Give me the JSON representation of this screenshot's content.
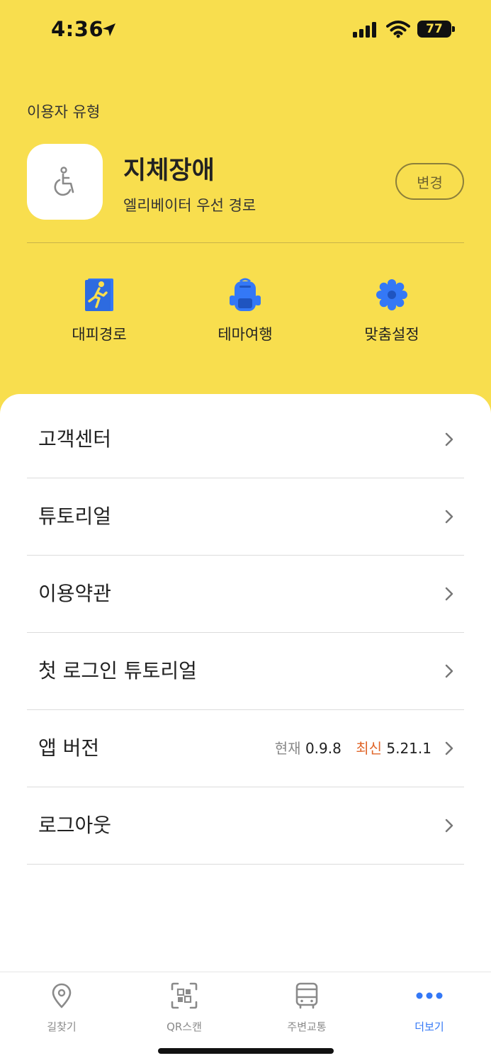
{
  "status_bar": {
    "time": "4:36",
    "battery": "77"
  },
  "user_type": {
    "section_label": "이용자 유형",
    "name": "지체장애",
    "description": "엘리베이터 우선 경로",
    "change_button": "변경"
  },
  "quick_actions": [
    {
      "label": "대피경로",
      "icon": "evacuation-icon"
    },
    {
      "label": "테마여행",
      "icon": "backpack-icon"
    },
    {
      "label": "맞춤설정",
      "icon": "gear-icon"
    }
  ],
  "menu": {
    "customer_center": "고객센터",
    "tutorial": "튜토리얼",
    "terms": "이용약관",
    "first_login_tutorial": "첫 로그인 튜토리얼",
    "app_version": {
      "label": "앱 버전",
      "current_label": "현재",
      "current_value": "0.9.8",
      "latest_label": "최신",
      "latest_value": "5.21.1"
    },
    "logout": "로그아웃"
  },
  "tabs": [
    {
      "label": "길찾기",
      "icon": "location-pin-icon",
      "active": false
    },
    {
      "label": "QR스캔",
      "icon": "qr-scan-icon",
      "active": false
    },
    {
      "label": "주변교통",
      "icon": "bus-icon",
      "active": false
    },
    {
      "label": "더보기",
      "icon": "more-dots-icon",
      "active": true
    }
  ],
  "colors": {
    "header_bg": "#f8de4e",
    "accent_blue": "#3478f6",
    "latest_orange": "#e0662a"
  }
}
